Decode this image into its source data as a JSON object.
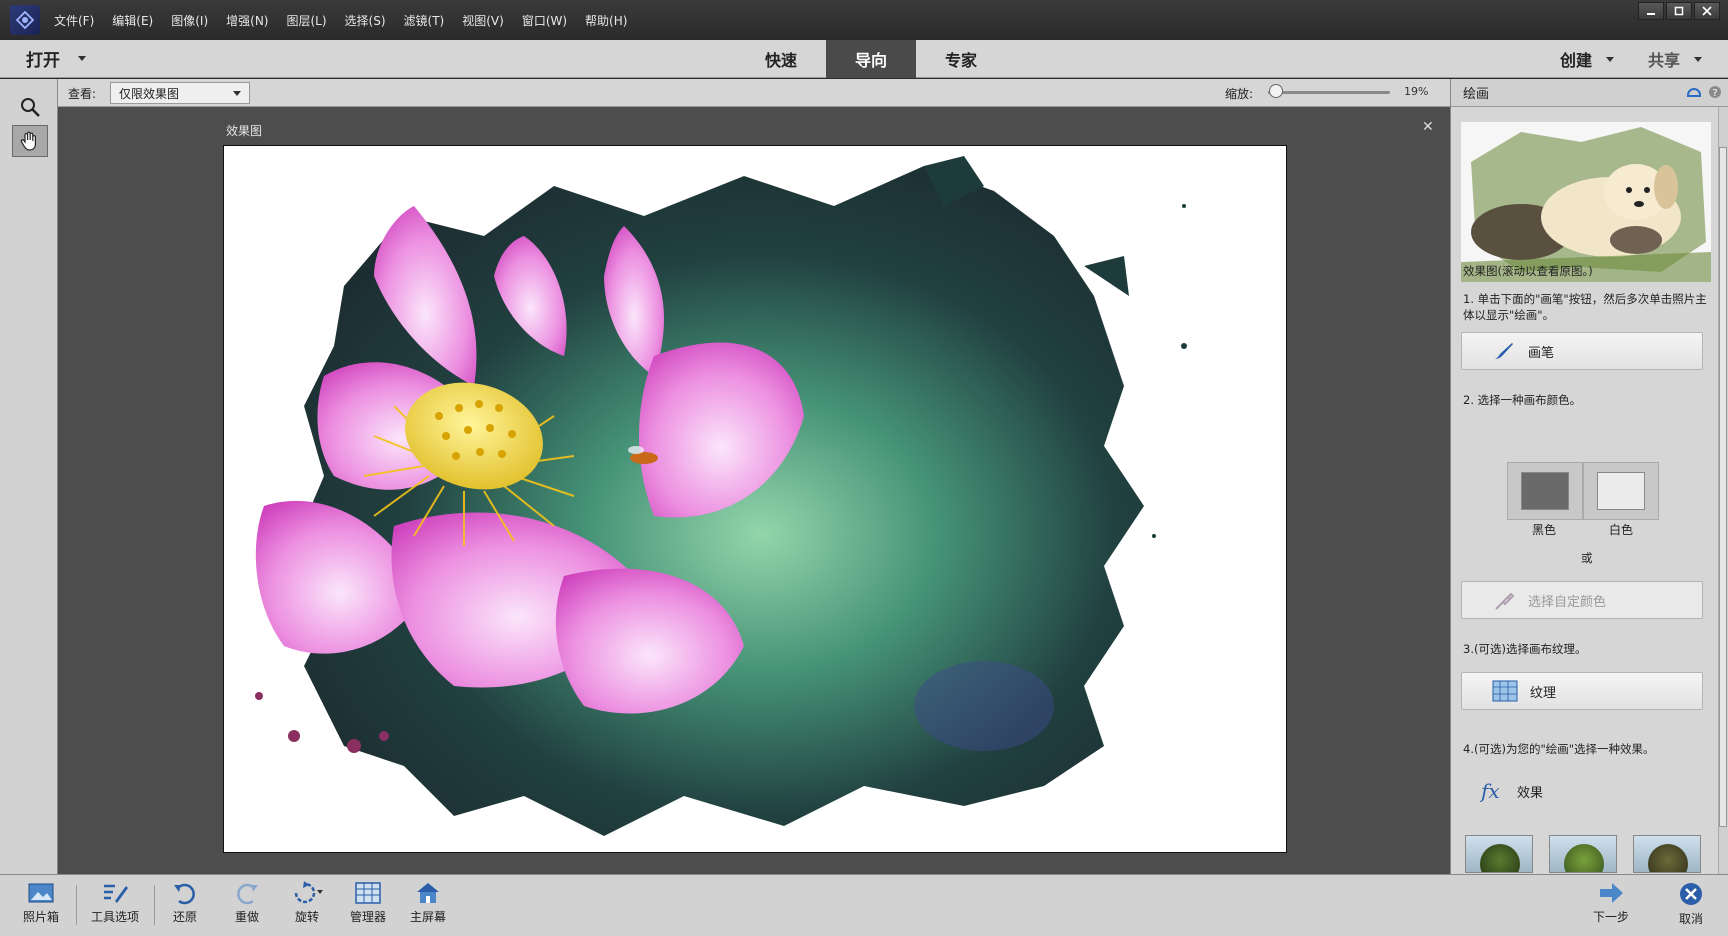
{
  "menu": [
    "文件(F)",
    "编辑(E)",
    "图像(I)",
    "增强(N)",
    "图层(L)",
    "选择(S)",
    "滤镜(T)",
    "视图(V)",
    "窗口(W)",
    "帮助(H)"
  ],
  "modebar": {
    "open_label": "打开",
    "tabs": [
      "快速",
      "导向",
      "专家"
    ],
    "active_tab": "导向",
    "create_label": "创建",
    "share_label": "共享"
  },
  "options": {
    "view_label": "查看:",
    "view_value": "仅限效果图",
    "zoom_label": "缩放:",
    "zoom_value": "19%",
    "zoom_fraction": 0.02
  },
  "document": {
    "title": "效果图",
    "close_glyph": "✕"
  },
  "panel": {
    "title": "绘画",
    "thumb_caption": "效果图(滚动以查看原图。)",
    "step1": "1. 单击下面的\"画笔\"按钮，然后多次单击照片主体以显示\"绘画\"。",
    "brush_label": "画笔",
    "step2": "2. 选择一种画布颜色。",
    "black_label": "黑色",
    "white_label": "白色",
    "or_label": "或",
    "custom_color_label": "选择自定颜色",
    "step3": "3.(可选)选择画布纹理。",
    "texture_label": "纹理",
    "step4": "4.(可选)为您的\"绘画\"选择一种效果。",
    "effects_label": "效果",
    "colors": {
      "black": "#6a6a6a",
      "white": "#ececec"
    }
  },
  "bottom": {
    "items": [
      "照片箱",
      "工具选项",
      "还原",
      "重做",
      "旋转",
      "管理器",
      "主屏幕"
    ],
    "next_label": "下一步",
    "cancel_label": "取消"
  },
  "colors": {
    "accent": "#4a4a4a",
    "lotus": "#e468c8",
    "canvas_bg": "#4d4d4d"
  }
}
